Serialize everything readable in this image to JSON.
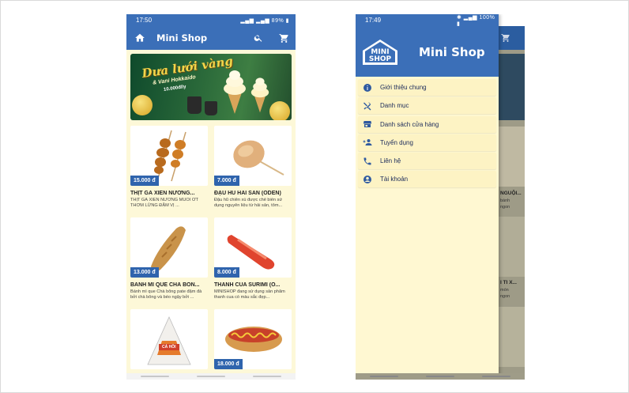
{
  "phone1": {
    "status": {
      "time": "17:50",
      "battery": "89%"
    },
    "appbar": {
      "title": "Mini Shop"
    },
    "banner": {
      "line1": "Dưa lưới vàng",
      "line2": "& Vani Hokkaido",
      "line3": "10.000đ/ly"
    },
    "products": [
      {
        "price": "15.000 đ",
        "name": "THỊT GÀ XIÊN NƯỚNG...",
        "desc": "THỊT GÀ XIÊN NƯỚNG MUỐI ỚT THƠM LỪNG ĐẬM VỊ ..."
      },
      {
        "price": "7.000 đ",
        "name": "ĐẬU HŨ HẢI SẢN (ODEN)",
        "desc": "Đậu hũ chiên xù được chế biến sử dụng nguyên liệu từ hải sản, tôm..."
      },
      {
        "price": "13.000 đ",
        "name": "BÁNH MÌ QUE CHÀ BÔN...",
        "desc": "Bánh mì que Chà bông pate đậm đà bởi chà bông và béo ngậy bởi ..."
      },
      {
        "price": "8.000 đ",
        "name": "THANH CUA SURIMI (O...",
        "desc": "MINISHOP đang sử dụng sản phẩm thanh cua có màu sắc đẹp..."
      },
      {
        "price": "",
        "name": "",
        "desc": "",
        "label": "CÁ HỒI"
      },
      {
        "price": "18.000 đ",
        "name": "",
        "desc": ""
      }
    ]
  },
  "phone2": {
    "status": {
      "time": "17:49",
      "battery": "100%"
    },
    "drawer": {
      "logo_text_1": "MINI",
      "logo_text_2": "SHOP",
      "title": "Mini Shop",
      "menu": [
        {
          "icon": "info-icon",
          "label": "Giới thiệu chung"
        },
        {
          "icon": "restaurant-icon",
          "label": "Danh mục"
        },
        {
          "icon": "store-icon",
          "label": "Danh sách cửa hàng"
        },
        {
          "icon": "person-add-icon",
          "label": "Tuyển dụng"
        },
        {
          "icon": "phone-icon",
          "label": "Liên hệ"
        },
        {
          "icon": "account-icon",
          "label": "Tài khoản"
        }
      ]
    },
    "background_fragments": {
      "name1": "NGUỘI...",
      "desc1a": "bánh",
      "desc1b": "ngon",
      "name2": "I TI X...",
      "desc2a": "món",
      "desc2b": "ngon"
    }
  },
  "colors": {
    "primary": "#3b6fb8",
    "price_tag": "#2f64ad",
    "content_bg": "#fdf8d8",
    "drawer_bg": "#fff8d2"
  }
}
